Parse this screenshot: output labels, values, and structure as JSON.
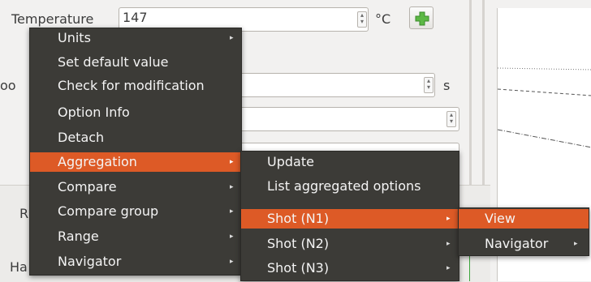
{
  "form": {
    "temperature_label": "Temperature",
    "temperature_value": "147",
    "temperature_unit": "°C",
    "time_label_fragment": "oo",
    "time_unit": "s",
    "lower_label_1": "R",
    "lower_label_2": "Ha"
  },
  "menu_main": {
    "items": [
      {
        "label": "Units",
        "submenu": true
      },
      {
        "label": "Set default value",
        "submenu": false
      },
      {
        "label": "Check for modification",
        "submenu": false
      },
      {
        "label": "Option Info",
        "submenu": false
      },
      {
        "label": "Detach",
        "submenu": false
      },
      {
        "label": "Aggregation",
        "submenu": true,
        "highlighted": true
      },
      {
        "label": "Compare",
        "submenu": true
      },
      {
        "label": "Compare group",
        "submenu": true
      },
      {
        "label": "Range",
        "submenu": true
      },
      {
        "label": "Navigator",
        "submenu": true
      }
    ]
  },
  "menu_aggregation": {
    "items": [
      {
        "label": "Update",
        "submenu": false
      },
      {
        "label": "List aggregated options",
        "submenu": false
      },
      {
        "label": "Shot  (N1)",
        "submenu": true,
        "highlighted": true
      },
      {
        "label": "Shot  (N2)",
        "submenu": true
      },
      {
        "label": "Shot  (N3)",
        "submenu": true
      }
    ]
  },
  "menu_shot": {
    "items": [
      {
        "label": "View",
        "submenu": false,
        "highlighted": true
      },
      {
        "label": "Navigator",
        "submenu": true
      }
    ]
  },
  "icons": {
    "submenu_arrow": "▸",
    "spin_up": "▴",
    "spin_down": "▾"
  },
  "colors": {
    "menu_bg": "#3c3b37",
    "highlight": "#dd5a26",
    "plus_icon": "#4caf3c"
  }
}
